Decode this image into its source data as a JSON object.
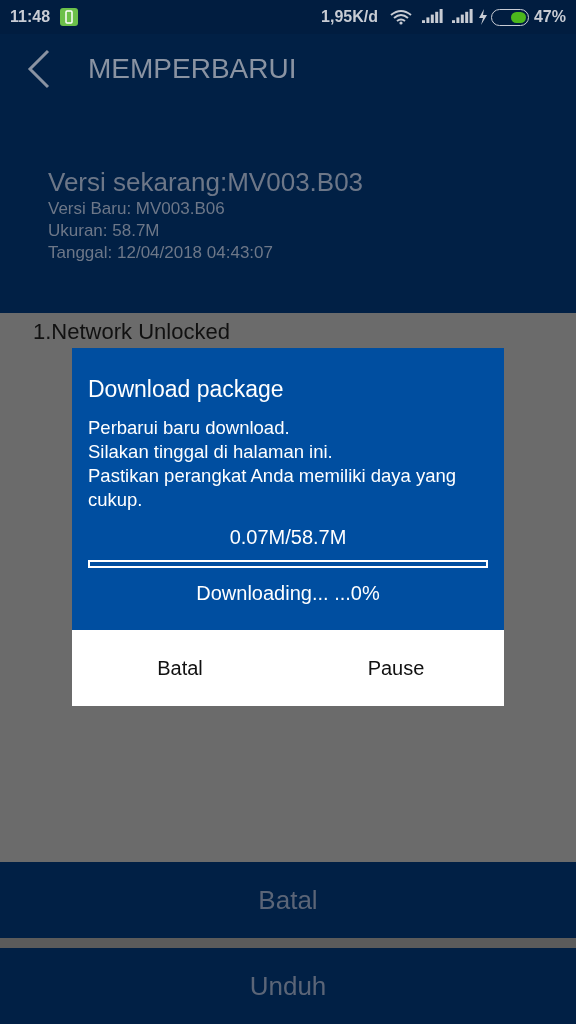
{
  "status_bar": {
    "time": "11:48",
    "speed": "1,95K/d",
    "battery_percent": "47%"
  },
  "header": {
    "title": "MEMPERBARUI"
  },
  "info": {
    "current_version": "Versi sekarang:MV003.B03",
    "lines": [
      "Versi Baru: MV003.B06",
      "Ukuran: 58.7M",
      "Tanggal: 12/04/2018 04:43:07"
    ]
  },
  "changelog": [
    "1.Network Unlocked"
  ],
  "dialog": {
    "title": "Download package",
    "message": [
      "Perbarui baru download.",
      "Silakan tinggal di halaman ini.",
      "Pastikan perangkat Anda memiliki daya yang cukup."
    ],
    "size": "0.07M/58.7M",
    "progress": {
      "level": 0.0
    },
    "status": "Downloading... ...0%",
    "buttons": [
      "Batal",
      "Pause"
    ]
  },
  "buttons": [
    "Batal",
    "Unduh"
  ]
}
